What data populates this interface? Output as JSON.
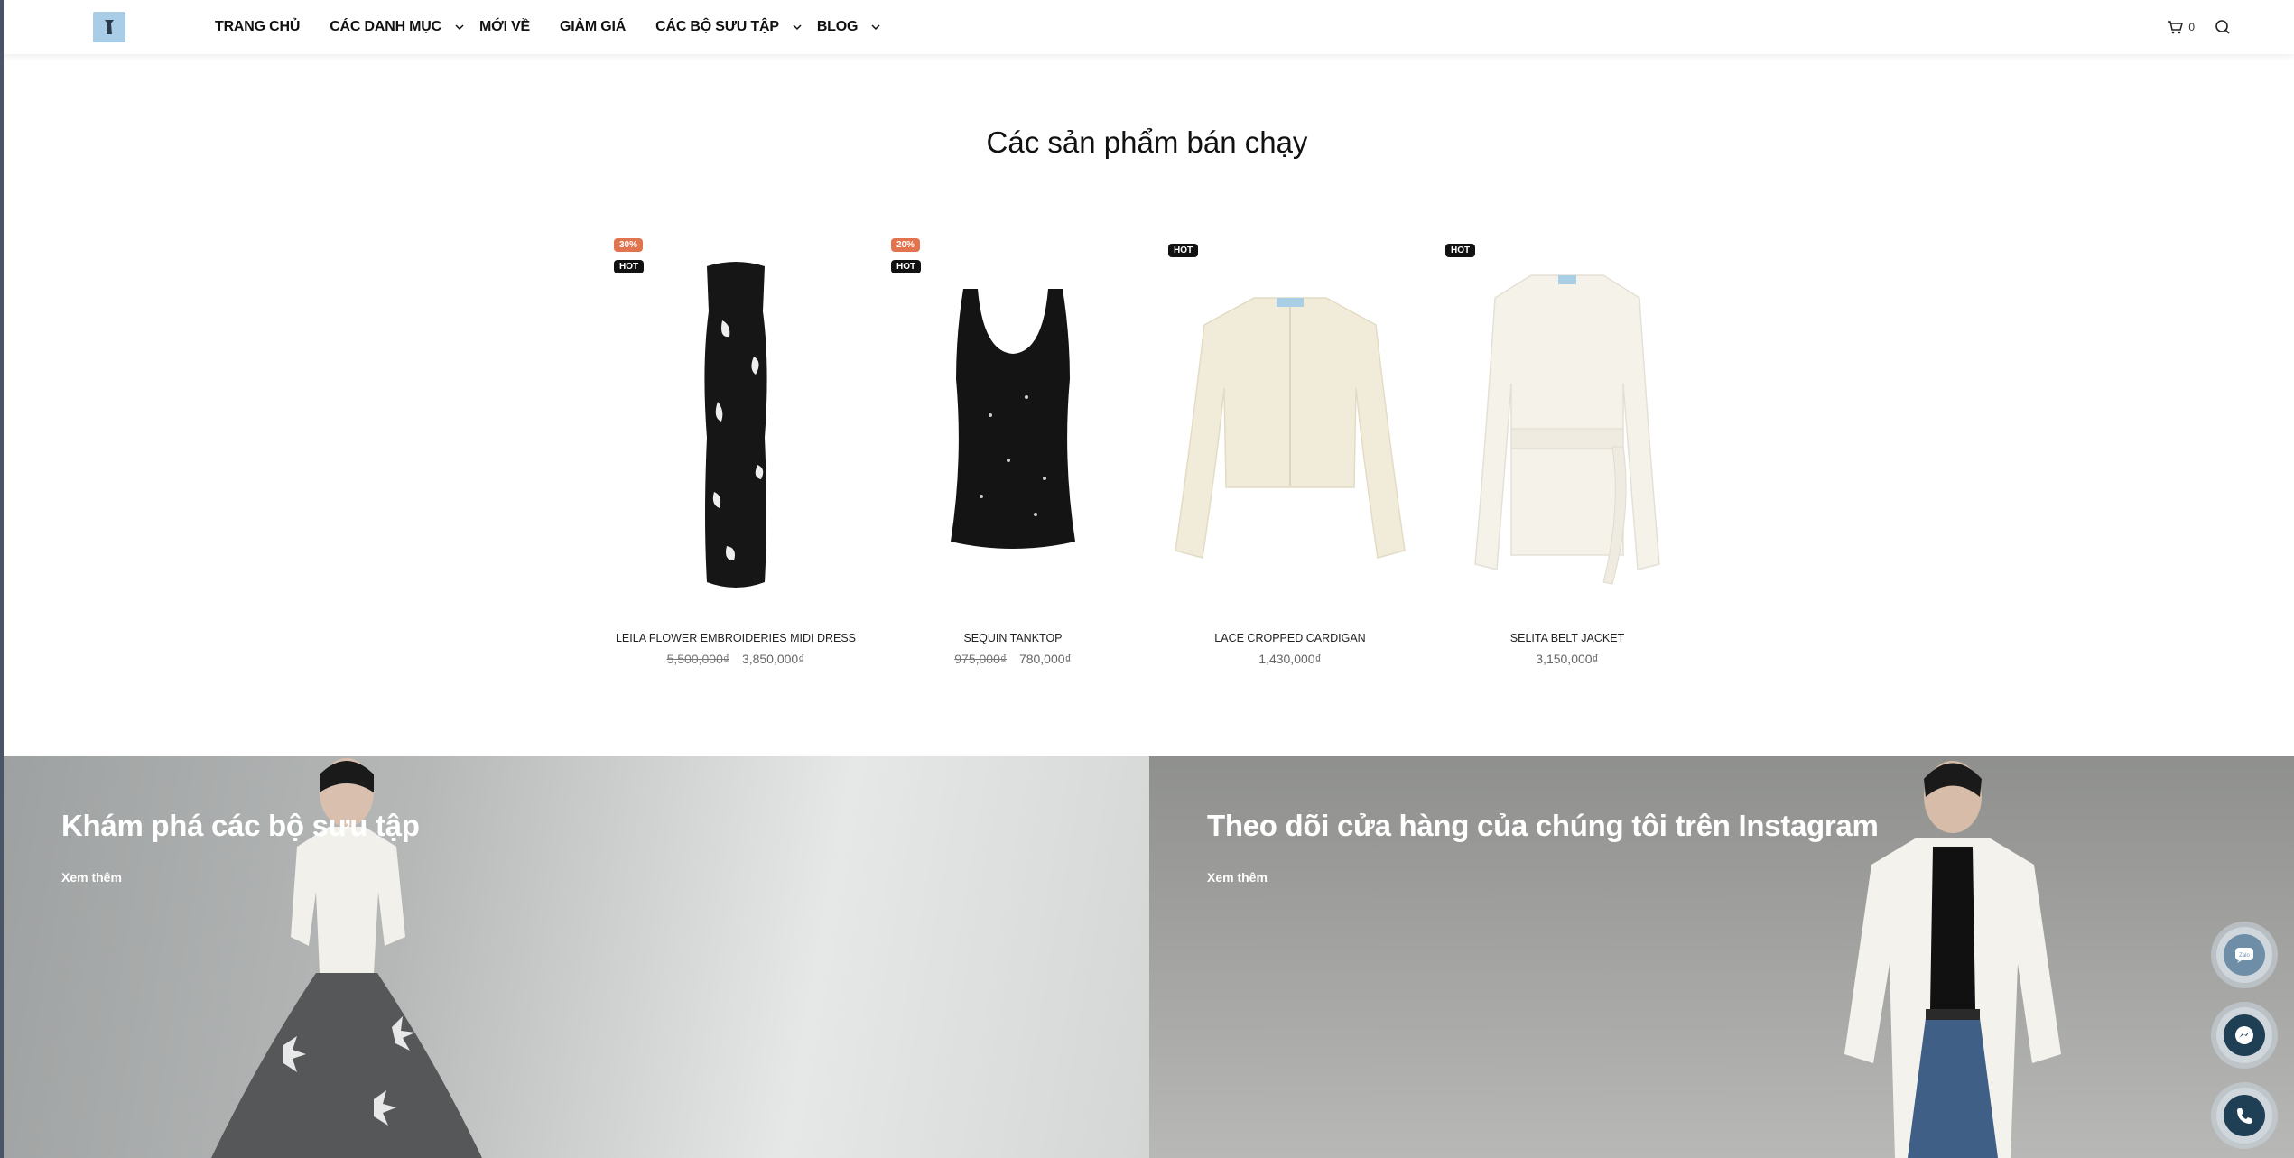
{
  "header": {
    "logo_icon": "store-logo",
    "nav": [
      {
        "label": "TRANG CHỦ",
        "dropdown": false
      },
      {
        "label": "CÁC DANH MỤC",
        "dropdown": true
      },
      {
        "label": "MỚI VỀ",
        "dropdown": false
      },
      {
        "label": "GIẢM GIÁ",
        "dropdown": false
      },
      {
        "label": "CÁC BỘ SƯU TẬP",
        "dropdown": true
      },
      {
        "label": "BLOG",
        "dropdown": true
      }
    ],
    "cart_count": "0",
    "cart_icon": "cart-icon",
    "search_icon": "search-icon"
  },
  "bestsellers": {
    "title": "Các sản phẩm bán chạy",
    "products": [
      {
        "name": "LEILA FLOWER EMBROIDERIES MIDI DRESS",
        "old_price": "5,500,000₫",
        "price": "3,850,000₫",
        "sale_badge": "30%",
        "hot_badge": "HOT"
      },
      {
        "name": "SEQUIN TANKTOP",
        "old_price": "975,000₫",
        "price": "780,000₫",
        "sale_badge": "20%",
        "hot_badge": "HOT"
      },
      {
        "name": "LACE CROPPED CARDIGAN",
        "old_price": "",
        "price": "1,430,000₫",
        "sale_badge": "",
        "hot_badge": "HOT"
      },
      {
        "name": "SELITA BELT JACKET",
        "old_price": "",
        "price": "3,150,000₫",
        "sale_badge": "",
        "hot_badge": "HOT"
      }
    ]
  },
  "banners": [
    {
      "title": "Khám phá các bộ sưu tập",
      "link": "Xem thêm"
    },
    {
      "title": "Theo dõi cửa hàng của chúng tôi trên Instagram",
      "link": "Xem thêm"
    }
  ],
  "floating": [
    "zalo-icon",
    "messenger-icon",
    "phone-icon"
  ],
  "colors": {
    "sale_badge": "#e2734f",
    "hot_badge": "#111111",
    "float_dark": "#1f3f55"
  }
}
